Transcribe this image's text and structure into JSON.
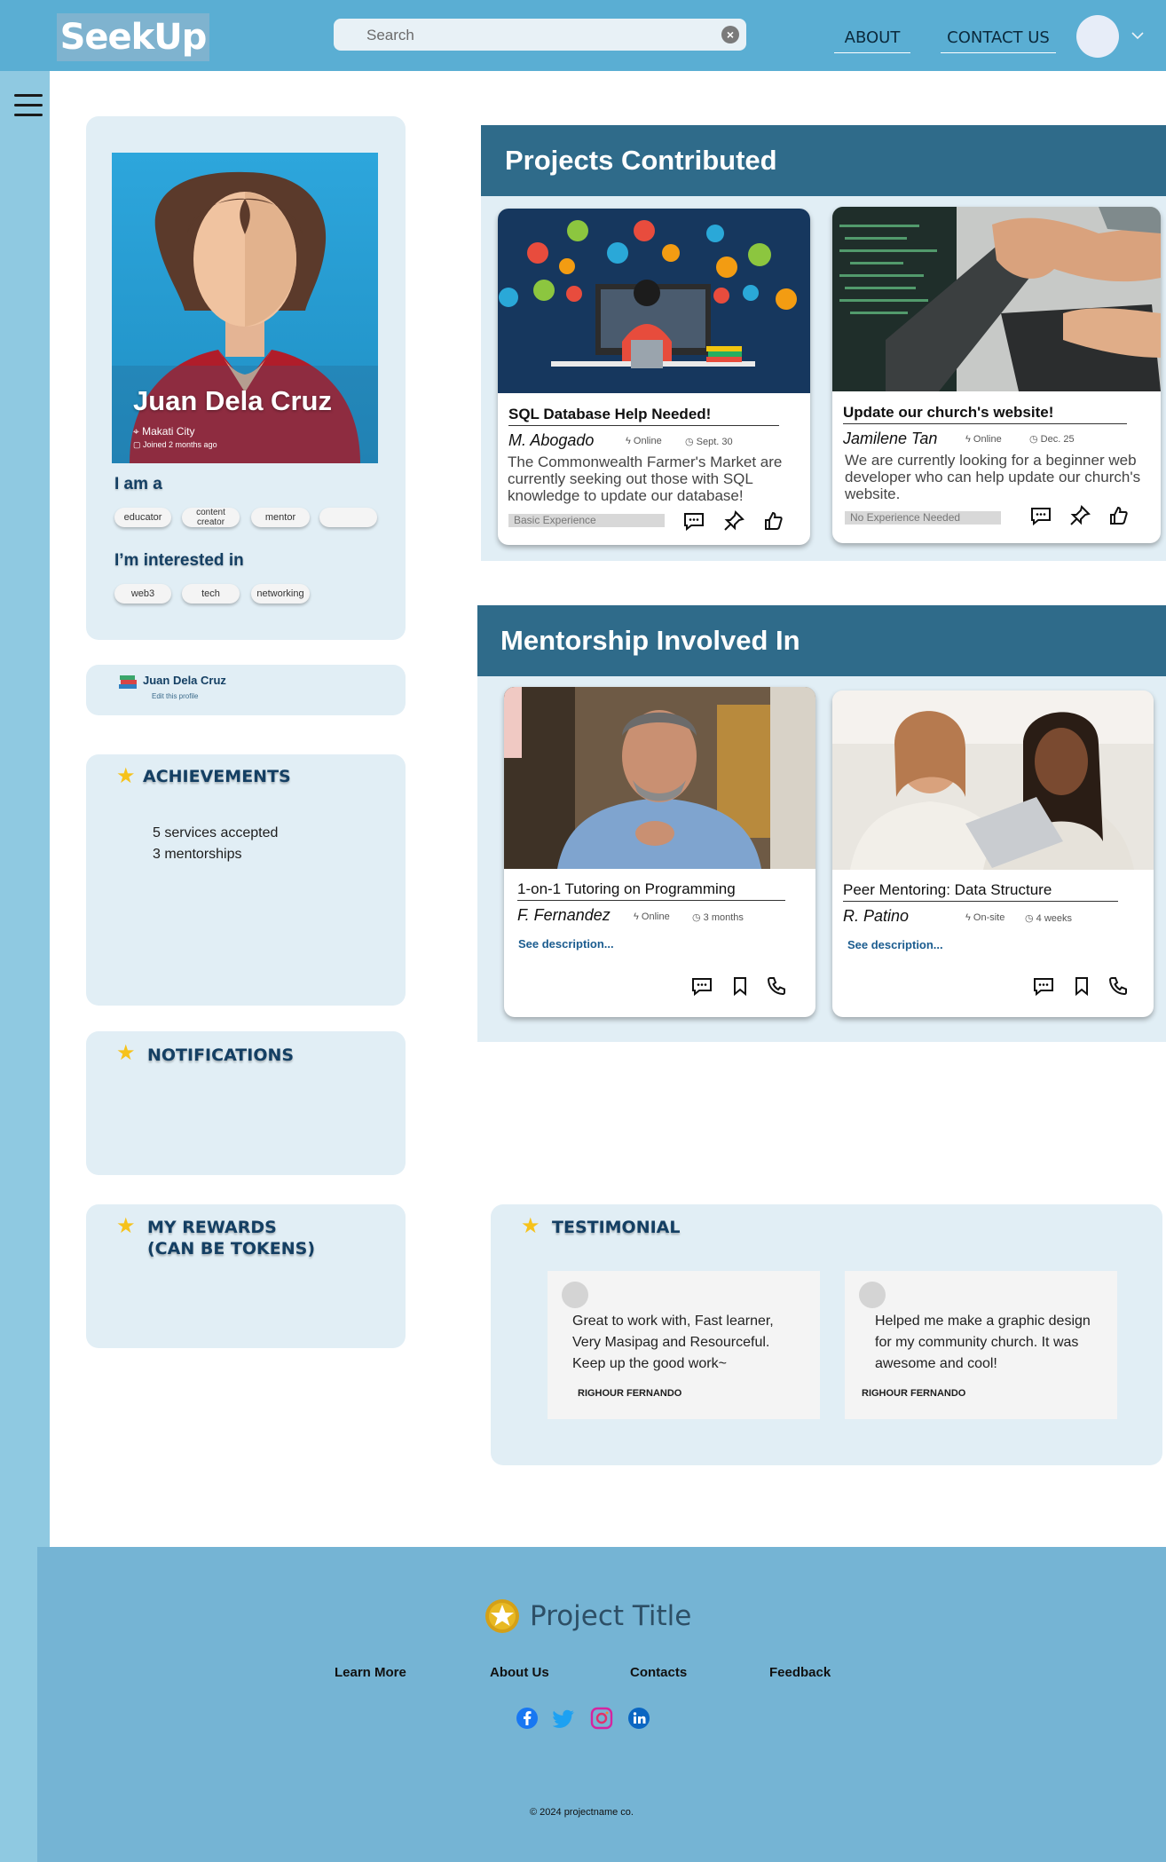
{
  "header": {
    "logo": "SeekUp",
    "search_placeholder": "Search",
    "nav": {
      "about": "ABOUT",
      "contact": "CONTACT US"
    }
  },
  "profile": {
    "name": "Juan Dela Cruz",
    "city": "Makati City",
    "joined": "Joined 2 months ago",
    "iam_heading": "I am a",
    "roles": [
      "educator",
      "content creator",
      "mentor",
      ""
    ],
    "interest_heading": "I’m interested in",
    "interests": [
      "web3",
      "tech",
      "networking"
    ]
  },
  "edit_card": {
    "name": "Juan Dela Cruz",
    "link": "Edit this profile"
  },
  "achievements": {
    "title": "ACHIEVEMENTS",
    "items": [
      "5 services accepted",
      "3 mentorships"
    ]
  },
  "notifications": {
    "title": "NOTIFICATIONS"
  },
  "rewards": {
    "title_line1": "MY REWARDS",
    "title_line2": "(CAN BE TOKENS)"
  },
  "projects": {
    "heading": "Projects Contributed",
    "cards": [
      {
        "title": "SQL Database Help Needed!",
        "author": "M. Abogado",
        "status": "Online",
        "date": "Sept. 30",
        "description": "The Commonwealth Farmer's Market are currently seeking out those with SQL knowledge to update our database!",
        "tag": "Basic Experience"
      },
      {
        "title": "Update our church's website!",
        "author": "Jamilene Tan",
        "status": "Online",
        "date": "Dec. 25",
        "description": "We are currently looking for a beginner web developer who can help update our church's website.",
        "tag": "No Experience Needed"
      }
    ]
  },
  "mentorship": {
    "heading": "Mentorship Involved In",
    "cards": [
      {
        "title": "1-on-1 Tutoring on Programming",
        "author": "F. Fernandez",
        "mode": "Online",
        "duration": "3 months",
        "link": "See description..."
      },
      {
        "title": "Peer Mentoring: Data Structure",
        "author": "R. Patino",
        "mode": "On-site",
        "duration": "4 weeks",
        "link": "See description..."
      }
    ]
  },
  "testimonial": {
    "title": "TESTIMONIAL",
    "items": [
      {
        "text": "Great to work with, Fast learner, Very Masipag and Resourceful. Keep up the good work~",
        "author": "RIGHOUR FERNANDO"
      },
      {
        "text": "Helped me make a graphic design for my community church. It was awesome and cool!",
        "author": "RIGHOUR FERNANDO"
      }
    ]
  },
  "footer": {
    "title": "Project Title",
    "links": [
      "Learn More",
      "About Us",
      "Contacts",
      "Feedback"
    ],
    "social": [
      "facebook-icon",
      "twitter-icon",
      "instagram-icon",
      "linkedin-icon"
    ],
    "copyright": "© 2024 projectname co."
  },
  "colors": {
    "header_bg": "#5aaed3",
    "section_header": "#2f6b8a",
    "panel_bg": "#e1eef5",
    "footer_bg": "#75b4d4",
    "accent_star": "#f6c21b"
  }
}
